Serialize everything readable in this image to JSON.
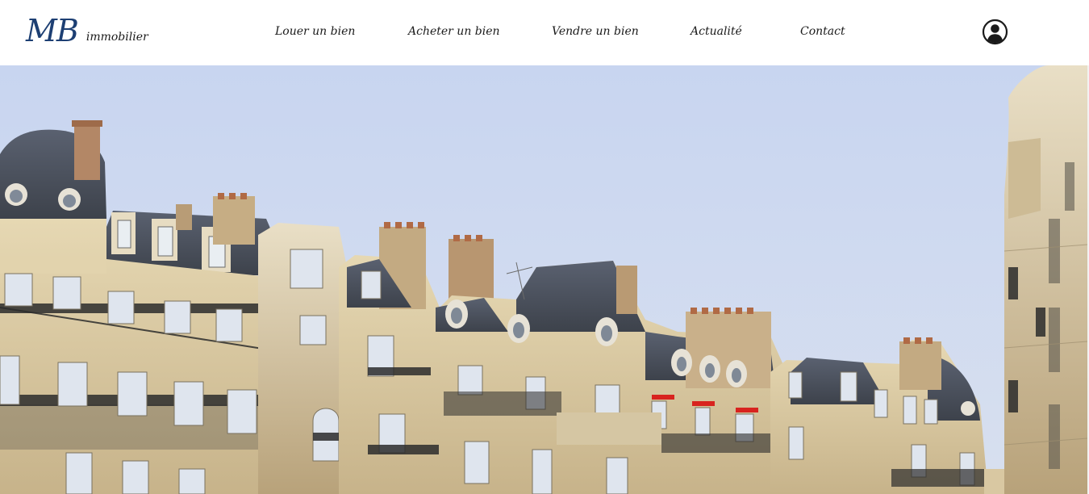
{
  "header": {
    "logo_mark": "MB",
    "logo_word": "immobilier",
    "nav": [
      {
        "label": "Louer un bien"
      },
      {
        "label": "Acheter un bien"
      },
      {
        "label": "Vendre un bien"
      },
      {
        "label": "Actualité"
      },
      {
        "label": "Contact"
      }
    ],
    "account_icon": "user-circle-icon"
  },
  "hero": {
    "image": "parisian-haussmann-buildings-photo",
    "sky_color": "#c9d6ee",
    "stone_color": "#d9c9a1",
    "roof_color": "#4a4f58"
  },
  "colors": {
    "brand": "#1d3f73",
    "text": "#1a1a1a",
    "header_bg": "#ffffff"
  }
}
